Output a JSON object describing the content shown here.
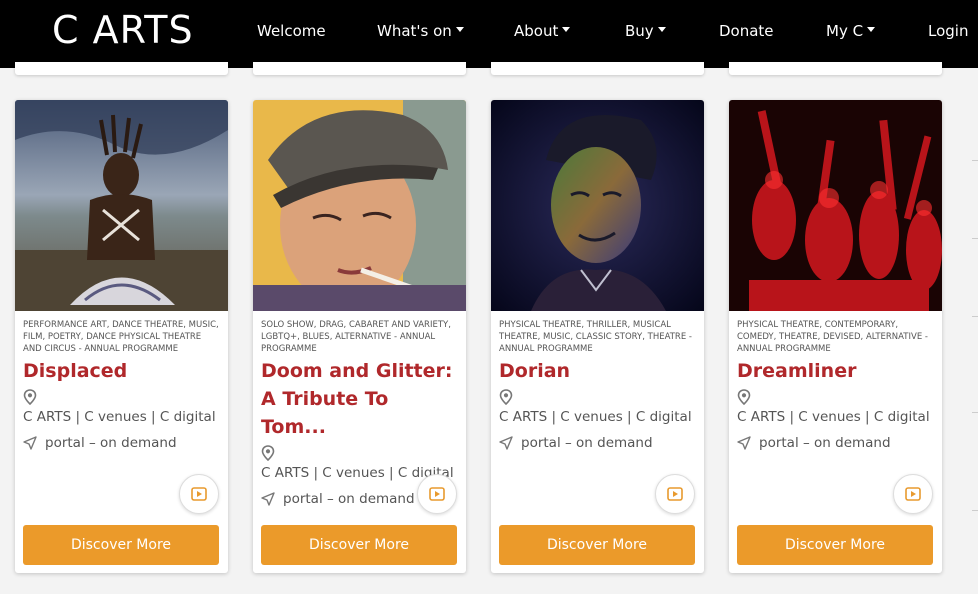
{
  "nav": {
    "logo": "C ARTS",
    "items": [
      {
        "label": "Welcome",
        "dropdown": false
      },
      {
        "label": "What's on",
        "dropdown": true
      },
      {
        "label": "About",
        "dropdown": true
      },
      {
        "label": "Buy",
        "dropdown": true
      },
      {
        "label": "Donate",
        "dropdown": false
      },
      {
        "label": "My C",
        "dropdown": true
      },
      {
        "label": "Login",
        "dropdown": false
      }
    ]
  },
  "cards": [
    {
      "genres": "PERFORMANCE ART, DANCE THEATRE, MUSIC, FILM, POETRY, DANCE PHYSICAL THEATRE AND CIRCUS - ANNUAL PROGRAMME",
      "title": "Displaced",
      "venue": "C ARTS | C venues | C digital",
      "portal": "portal – on demand",
      "button": "Discover More",
      "image_icon": "performer-photo"
    },
    {
      "genres": "SOLO SHOW, DRAG, CABARET AND VARIETY, LGBTQ+, BLUES, ALTERNATIVE - ANNUAL PROGRAMME",
      "title": "Doom and Glitter: A Tribute To Tom...",
      "venue": "C ARTS | C venues | C digital",
      "portal": "portal – on demand",
      "button": "Discover More",
      "image_icon": "performer-photo"
    },
    {
      "genres": "PHYSICAL THEATRE, THRILLER, MUSICAL THEATRE, MUSIC, CLASSIC STORY, THEATRE - ANNUAL PROGRAMME",
      "title": "Dorian",
      "venue": "C ARTS | C venues | C digital",
      "portal": "portal – on demand",
      "button": "Discover More",
      "image_icon": "performer-photo"
    },
    {
      "genres": "PHYSICAL THEATRE, CONTEMPORARY, COMEDY, THEATRE, DEVISED, ALTERNATIVE - ANNUAL PROGRAMME",
      "title": "Dreamliner",
      "venue": "C ARTS | C venues | C digital",
      "portal": "portal – on demand",
      "button": "Discover More",
      "image_icon": "performer-photo"
    }
  ],
  "colors": {
    "title": "#b0282b",
    "button": "#eb9a2a",
    "navbar": "#000000"
  }
}
